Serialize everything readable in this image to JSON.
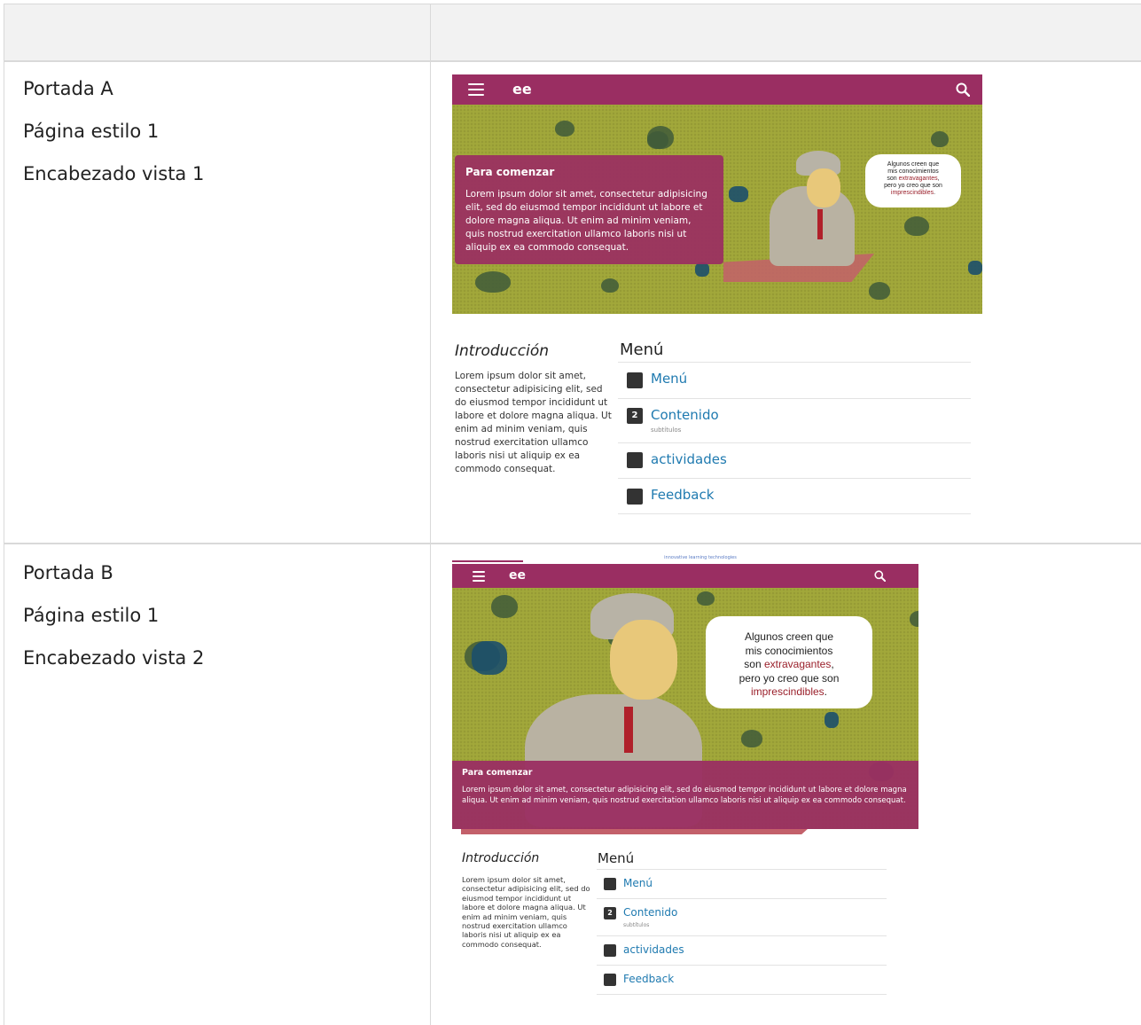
{
  "rows": [
    {
      "lines": [
        "Portada A",
        "Página estilo 1",
        "Encabezado vista 1"
      ]
    },
    {
      "lines": [
        "Portada B",
        "Página estilo 1",
        "Encabezado vista 2"
      ]
    }
  ],
  "preview": {
    "app_name": "ee",
    "brand_tag": "innovative learning technologies",
    "card_title": "Para comenzar",
    "card_text": "Lorem ipsum dolor sit amet, consectetur adipisicing elit, sed do eiusmod tempor incididunt ut labore et dolore magna aliqua. Ut enim ad minim veniam, quis nostrud exercitation ullamco laboris nisi ut aliquip ex ea commodo consequat.",
    "bubble": {
      "l1": "Algunos creen que",
      "l2": "mis conocimientos",
      "l3_a": "son ",
      "l3_b": "extravagantes",
      "l3_c": ",",
      "l4": "pero yo creo que son",
      "l5_a": "imprescindibles",
      "l5_b": "."
    },
    "intro_title": "Introducción",
    "intro_text": "Lorem ipsum dolor sit amet, consectetur adipisicing elit, sed do eiusmod tempor incididunt ut labore et dolore magna aliqua. Ut enim ad minim veniam, quis nostrud exercitation ullamco laboris nisi ut aliquip ex ea commodo consequat.",
    "menu_title": "Menú",
    "menu": [
      {
        "label": "Menú",
        "badge": "",
        "sub": ""
      },
      {
        "label": "Contenido",
        "badge": "2",
        "sub": "subtítulos"
      },
      {
        "label": "actividades",
        "badge": "",
        "sub": ""
      },
      {
        "label": "Feedback",
        "badge": "",
        "sub": ""
      }
    ]
  },
  "colors": {
    "brand": "#9a2e62",
    "banner": "#a2a83a",
    "link": "#1f7ab0"
  }
}
